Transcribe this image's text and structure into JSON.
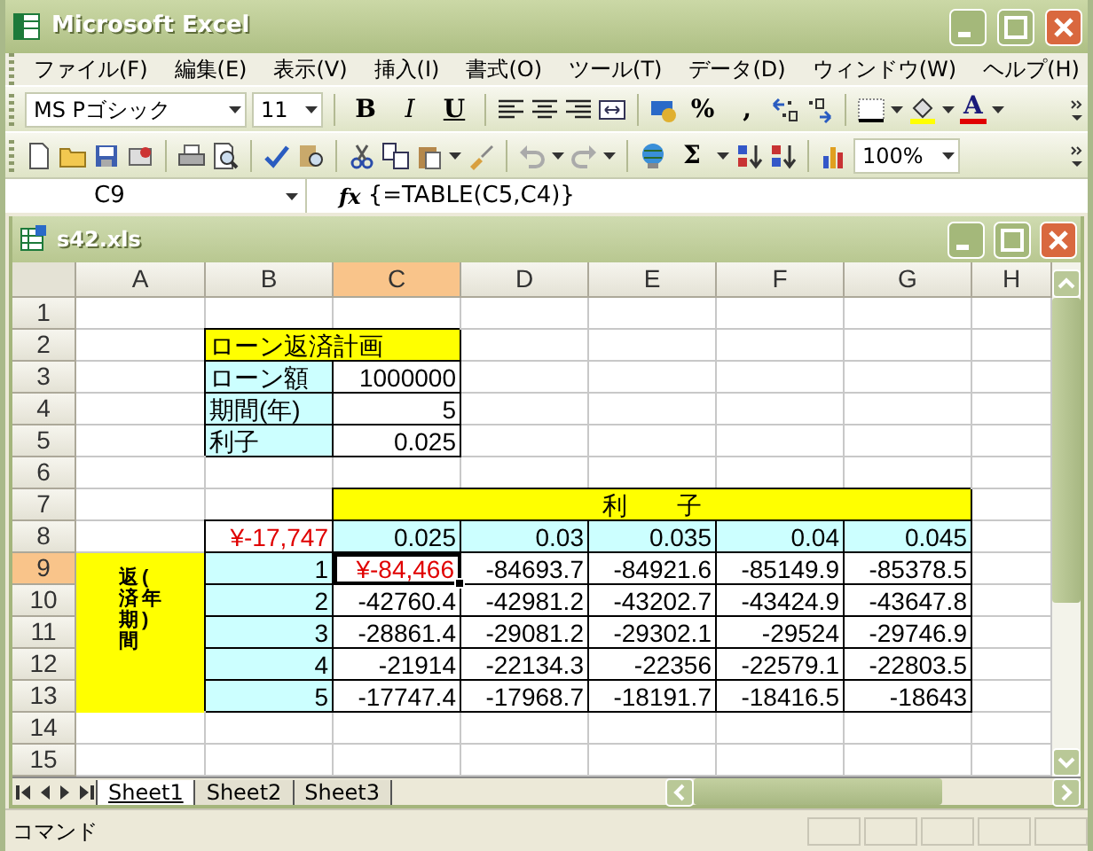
{
  "window": {
    "title": "Microsoft Excel"
  },
  "menu": [
    "ファイル(F)",
    "編集(E)",
    "表示(V)",
    "挿入(I)",
    "書式(O)",
    "ツール(T)",
    "データ(D)",
    "ウィンドウ(W)",
    "ヘルプ(H)"
  ],
  "formatting_toolbar": {
    "font": "MS Pゴシック",
    "size": "11",
    "style_buttons": [
      "B",
      "I",
      "U"
    ],
    "percent": "%",
    "comma": ",",
    "font_color": "A"
  },
  "standard_toolbar": {
    "sum": "Σ",
    "zoom": "100%"
  },
  "formula_bar": {
    "name_box": "C9",
    "function_label": "fx",
    "formula": "{=TABLE(C5,C4)}"
  },
  "workbook": {
    "title": "s42.xls",
    "columns": [
      {
        "label": "A",
        "selected": false
      },
      {
        "label": "B",
        "selected": false
      },
      {
        "label": "C",
        "selected": true
      },
      {
        "label": "D",
        "selected": false
      },
      {
        "label": "E",
        "selected": false
      },
      {
        "label": "F",
        "selected": false
      },
      {
        "label": "G",
        "selected": false
      },
      {
        "label": "H",
        "selected": false
      }
    ],
    "rows": [
      {
        "label": "1",
        "selected": false
      },
      {
        "label": "2",
        "selected": false,
        "cells": [
          {
            "kind": "empty"
          },
          {
            "kind": "text",
            "text": "ローン返済計画",
            "color": "#ffff00",
            "border": true,
            "selected": false
          },
          {
            "kind": "merged"
          }
        ]
      },
      {
        "label": "3",
        "selected": false,
        "cells": [
          {
            "kind": "empty"
          },
          {
            "kind": "text",
            "text": "ローン額",
            "color": "#ccffff",
            "border": true,
            "selected": false
          },
          {
            "kind": "number",
            "text": "1000000",
            "border": true,
            "selected": false
          }
        ]
      },
      {
        "label": "4",
        "selected": false,
        "cells": [
          {
            "kind": "empty"
          },
          {
            "kind": "text",
            "text": "期間(年)",
            "color": "#ccffff",
            "border": true,
            "selected": false
          },
          {
            "kind": "number",
            "text": "5",
            "border": true,
            "selected": false
          }
        ]
      },
      {
        "label": "5",
        "selected": false,
        "cells": [
          {
            "kind": "empty"
          },
          {
            "kind": "text",
            "text": "利子",
            "color": "#ccffff",
            "border": true,
            "selected": false
          },
          {
            "kind": "number",
            "text": "0.025",
            "border": true,
            "selected": false
          }
        ]
      },
      {
        "label": "6",
        "selected": false
      },
      {
        "label": "7",
        "selected": false,
        "cells": [
          {
            "kind": "empty"
          },
          {
            "kind": "empty"
          },
          {
            "kind": "heading",
            "text": "利　　子",
            "color": "#ffff00",
            "border": true,
            "selected": false
          },
          {
            "kind": "merged"
          },
          {
            "kind": "merged"
          },
          {
            "kind": "merged"
          },
          {
            "kind": "merged"
          }
        ]
      },
      {
        "label": "8",
        "selected": false,
        "cells": [
          {
            "kind": "empty"
          },
          {
            "kind": "currency",
            "text": "¥-17,747",
            "border": true,
            "selected": false
          },
          {
            "kind": "number",
            "text": "0.025",
            "color": "#ccffff",
            "border": true,
            "selected": false
          },
          {
            "kind": "number",
            "text": "0.03",
            "color": "#ccffff",
            "border": true,
            "selected": false
          },
          {
            "kind": "number",
            "text": "0.035",
            "color": "#ccffff",
            "border": true,
            "selected": false
          },
          {
            "kind": "number",
            "text": "0.04",
            "color": "#ccffff",
            "border": true,
            "selected": false
          },
          {
            "kind": "number",
            "text": "0.045",
            "color": "#ccffff",
            "border": true,
            "selected": false
          }
        ]
      },
      {
        "label": "9",
        "selected": true,
        "cells": [
          {
            "kind": "vertical",
            "lines": [
              "返済期間",
              "(年)"
            ],
            "color": "#ffff00",
            "border": false,
            "selected": false
          },
          {
            "kind": "number",
            "text": "1",
            "color": "#ccffff",
            "border": true,
            "selected": false
          },
          {
            "kind": "currency",
            "text": "¥-84,466",
            "border": true,
            "selected": true
          },
          {
            "kind": "number",
            "text": "-84693.7",
            "border": true,
            "selected": false
          },
          {
            "kind": "number",
            "text": "-84921.6",
            "border": true,
            "selected": false
          },
          {
            "kind": "number",
            "text": "-85149.9",
            "border": true,
            "selected": false
          },
          {
            "kind": "number",
            "text": "-85378.5",
            "border": true,
            "selected": false
          }
        ]
      },
      {
        "label": "10",
        "selected": false,
        "cells": [
          {
            "kind": "merged_above"
          },
          {
            "kind": "number",
            "text": "2",
            "color": "#ccffff",
            "border": true,
            "selected": false
          },
          {
            "kind": "number",
            "text": "-42760.4",
            "border": true,
            "selected": false
          },
          {
            "kind": "number",
            "text": "-42981.2",
            "border": true,
            "selected": false
          },
          {
            "kind": "number",
            "text": "-43202.7",
            "border": true,
            "selected": false
          },
          {
            "kind": "number",
            "text": "-43424.9",
            "border": true,
            "selected": false
          },
          {
            "kind": "number",
            "text": "-43647.8",
            "border": true,
            "selected": false
          }
        ]
      },
      {
        "label": "11",
        "selected": false,
        "cells": [
          {
            "kind": "merged_above"
          },
          {
            "kind": "number",
            "text": "3",
            "color": "#ccffff",
            "border": true,
            "selected": false
          },
          {
            "kind": "number",
            "text": "-28861.4",
            "border": true,
            "selected": false
          },
          {
            "kind": "number",
            "text": "-29081.2",
            "border": true,
            "selected": false
          },
          {
            "kind": "number",
            "text": "-29302.1",
            "border": true,
            "selected": false
          },
          {
            "kind": "number",
            "text": "-29524",
            "border": true,
            "selected": false
          },
          {
            "kind": "number",
            "text": "-29746.9",
            "border": true,
            "selected": false
          }
        ]
      },
      {
        "label": "12",
        "selected": false,
        "cells": [
          {
            "kind": "merged_above"
          },
          {
            "kind": "number",
            "text": "4",
            "color": "#ccffff",
            "border": true,
            "selected": false
          },
          {
            "kind": "number",
            "text": "-21914",
            "border": true,
            "selected": false
          },
          {
            "kind": "number",
            "text": "-22134.3",
            "border": true,
            "selected": false
          },
          {
            "kind": "number",
            "text": "-22356",
            "border": true,
            "selected": false
          },
          {
            "kind": "number",
            "text": "-22579.1",
            "border": true,
            "selected": false
          },
          {
            "kind": "number",
            "text": "-22803.5",
            "border": true,
            "selected": false
          }
        ]
      },
      {
        "label": "13",
        "selected": false,
        "cells": [
          {
            "kind": "merged_above"
          },
          {
            "kind": "number",
            "text": "5",
            "color": "#ccffff",
            "border": true,
            "selected": false
          },
          {
            "kind": "number",
            "text": "-17747.4",
            "border": true,
            "selected": false
          },
          {
            "kind": "number",
            "text": "-17968.7",
            "border": true,
            "selected": false
          },
          {
            "kind": "number",
            "text": "-18191.7",
            "border": true,
            "selected": false
          },
          {
            "kind": "number",
            "text": "-18416.5",
            "border": true,
            "selected": false
          },
          {
            "kind": "number",
            "text": "-18643",
            "border": true,
            "selected": false
          }
        ]
      },
      {
        "label": "14",
        "selected": false
      },
      {
        "label": "15",
        "selected": false
      }
    ]
  },
  "sheet_tabs": [
    {
      "label": "Sheet1",
      "selected": true
    },
    {
      "label": "Sheet2",
      "selected": false
    },
    {
      "label": "Sheet3",
      "selected": false
    }
  ],
  "status_bar": {
    "text": "コマンド"
  }
}
